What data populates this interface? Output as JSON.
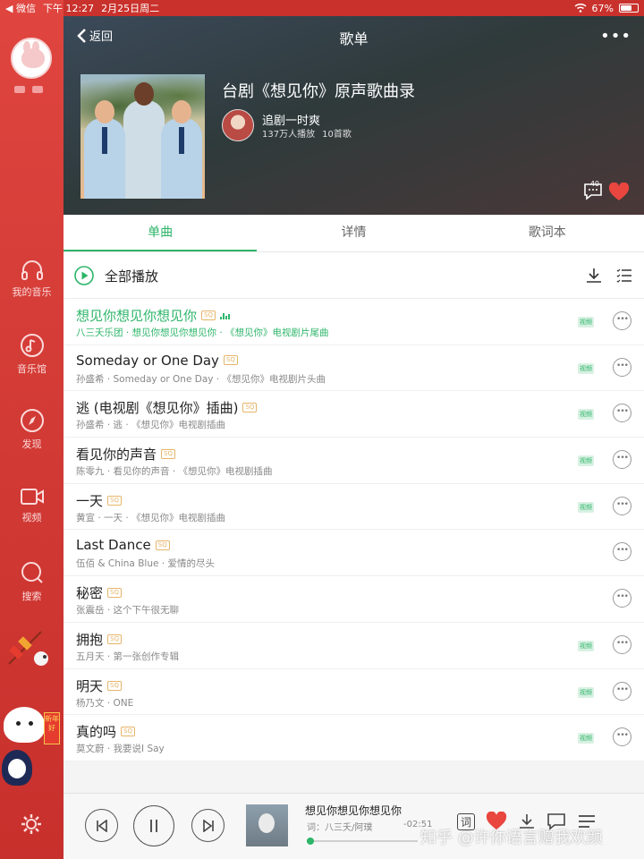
{
  "status_bar": {
    "back_app": "◀ 微信",
    "time": "下午 12:27",
    "date": "2月25日周二",
    "battery": "67%",
    "battery_level": 0.67
  },
  "sidebar": {
    "items": [
      {
        "label": "我的音乐",
        "icon": "headphones-icon"
      },
      {
        "label": "音乐馆",
        "icon": "music-note-icon"
      },
      {
        "label": "发现",
        "icon": "compass-icon"
      },
      {
        "label": "视频",
        "icon": "video-icon"
      },
      {
        "label": "搜索",
        "icon": "search-icon"
      }
    ],
    "sticker_text": "新年好"
  },
  "header": {
    "back_label": "返回",
    "title": "歌单",
    "more_label": "•••"
  },
  "playlist": {
    "title": "台剧《想见你》原声歌曲录",
    "creator": "追剧一时爽",
    "plays": "137万人播放",
    "song_count": "10首歌",
    "comment_count": "40"
  },
  "tabs": [
    {
      "label": "单曲",
      "active": true
    },
    {
      "label": "详情",
      "active": false
    },
    {
      "label": "歌词本",
      "active": false
    }
  ],
  "play_all": {
    "label": "全部播放"
  },
  "songs": [
    {
      "title": "想见你想见你想见你",
      "quality": "SQ",
      "sub": "八三夭乐团 · 想见你想见你想见你 · 《想见你》电视剧片尾曲",
      "mv": "视频",
      "playing": true
    },
    {
      "title": "Someday or One Day",
      "quality": "SQ",
      "sub": "孙盛希 · Someday or One Day · 《想见你》电视剧片头曲",
      "mv": "视频",
      "playing": false
    },
    {
      "title": "逃 (电视剧《想见你》插曲)",
      "quality": "SQ",
      "sub": "孙盛希 · 逃 · 《想见你》电视剧插曲",
      "mv": "视频",
      "playing": false
    },
    {
      "title": "看见你的声音",
      "quality": "SQ",
      "sub": "陈零九 · 看见你的声音 · 《想见你》电视剧插曲",
      "mv": "视频",
      "playing": false
    },
    {
      "title": "一天",
      "quality": "SQ",
      "sub": "黄宣 · 一天 · 《想见你》电视剧插曲",
      "mv": "视频",
      "playing": false
    },
    {
      "title": "Last Dance",
      "quality": "SQ",
      "sub": "伍佰 & China Blue · 爱情的尽头",
      "mv": "",
      "playing": false
    },
    {
      "title": "秘密",
      "quality": "SQ",
      "sub": "张震岳 · 这个下午很无聊",
      "mv": "",
      "playing": false
    },
    {
      "title": "拥抱",
      "quality": "SQ",
      "sub": "五月天 · 第一张创作专辑",
      "mv": "视频",
      "playing": false
    },
    {
      "title": "明天",
      "quality": "SQ",
      "sub": "杨乃文 · ONE",
      "mv": "视频",
      "playing": false
    },
    {
      "title": "真的吗",
      "quality": "SQ",
      "sub": "莫文蔚 · 我要说I Say",
      "mv": "视频",
      "playing": false
    }
  ],
  "player": {
    "now_playing": "想见你想见你想见你",
    "lyric": "词：八三夭/阿璞",
    "time": "-02:51",
    "progress": 0.03,
    "lyrics_btn": "词"
  },
  "watermark": "知乎 @许你语言赠我欢颜",
  "colors": {
    "accent": "#2db56a",
    "sidebar": "#d23a35",
    "favorite": "#e8463f"
  }
}
